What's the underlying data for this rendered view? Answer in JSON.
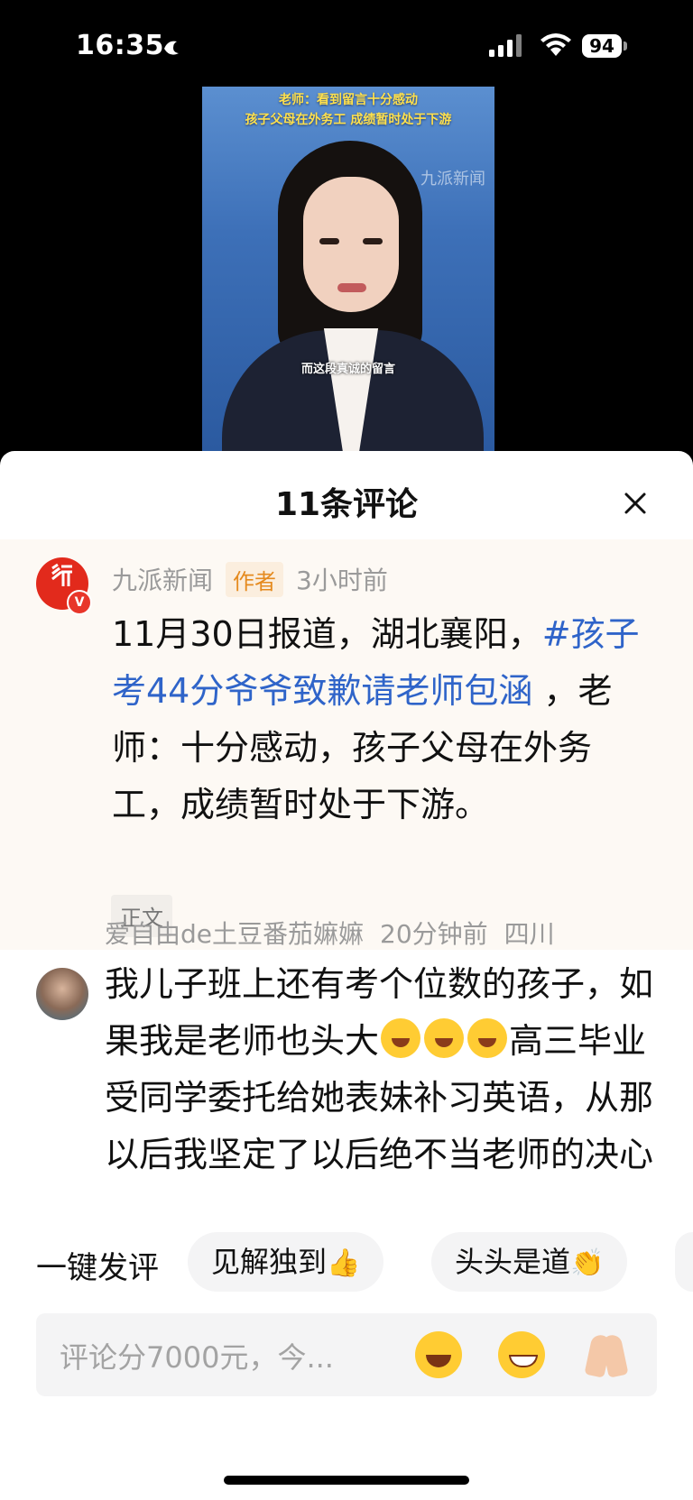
{
  "status_bar": {
    "time": "16:35",
    "battery": "94"
  },
  "video": {
    "headline_line1": "老师：看到留言十分感动",
    "headline_line2": "孩子父母在外务工 成绩暂时处于下游",
    "watermark": "九派新闻",
    "caption": "而这段真诚的留言"
  },
  "sheet": {
    "title": "11条评论"
  },
  "author_comment": {
    "name": "九派新闻",
    "tag": "作者",
    "time": "3小时前",
    "text_before": "11月30日报道，湖北襄阳，",
    "hashtag": "#孩子考44分爷爷致歉请老师包涵",
    "text_after": " ，老师：十分感动，孩子父母在外务工，成绩暂时处于下游。",
    "label": "正文"
  },
  "user_comment": {
    "name": "爱自由de土豆番茄嫲嫲",
    "time": "20分钟前",
    "location": "四川",
    "text_part1": "我儿子班上还有考个位数的孩子，如果我是老师也头大",
    "text_part2": "高三毕业受同学委托给她表妹补习英语，从那以后我坚定了以后绝不当老师的决心"
  },
  "quick_comments": {
    "label": "一键发评",
    "chips": [
      {
        "text": "见解独到",
        "emoji": "👍"
      },
      {
        "text": "头头是道",
        "emoji": "👏"
      }
    ]
  },
  "input": {
    "placeholder": "评论分7000元，今..."
  }
}
